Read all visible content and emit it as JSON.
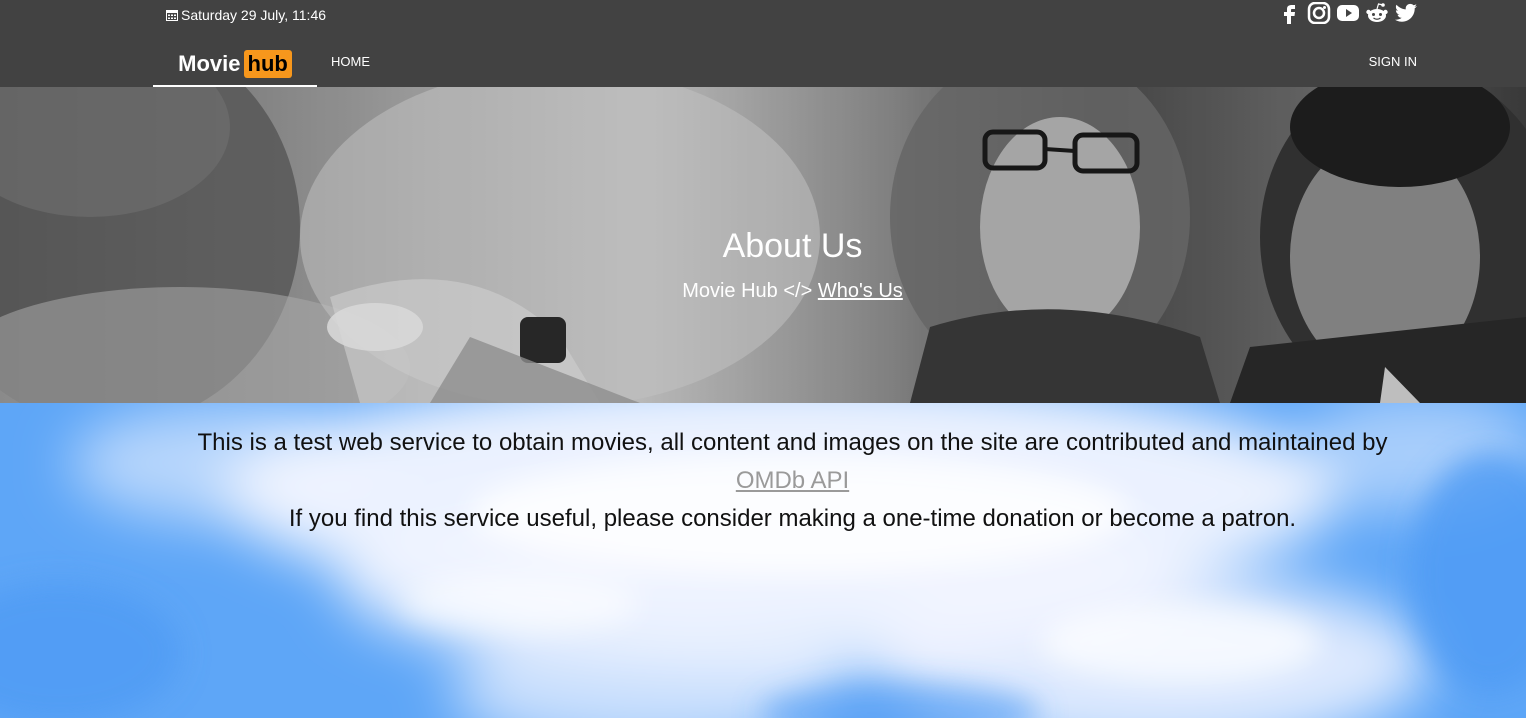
{
  "header": {
    "date_text": "Saturday 29 July, 11:46",
    "logo_movie": "Movie",
    "logo_hub": "hub",
    "nav_home": "HOME",
    "nav_signin": "SIGN IN",
    "social_icons": [
      "facebook-icon",
      "instagram-icon",
      "youtube-icon",
      "reddit-icon",
      "twitter-icon"
    ]
  },
  "hero": {
    "title": "About Us",
    "crumb_prefix": "Movie Hub </>",
    "crumb_link": "Who's Us"
  },
  "content": {
    "line1": "This is a test web service to obtain movies, all content and images on the site are contributed and maintained by",
    "link": "OMDb API",
    "line2": "If you find this service useful, please consider making a one-time donation or become a patron."
  },
  "colors": {
    "topbar": "#424242",
    "logo_accent": "#f7971c",
    "sky": "#5ea6f7"
  }
}
